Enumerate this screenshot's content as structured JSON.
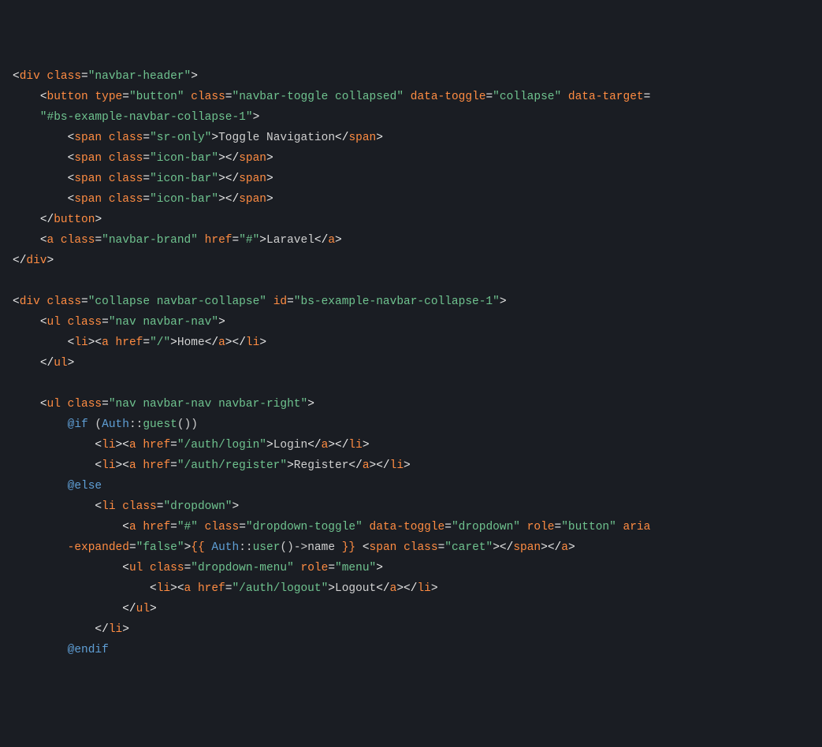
{
  "t": {
    "div": "div",
    "button": "button",
    "span": "span",
    "a": "a",
    "ul": "ul",
    "li": "li"
  },
  "a": {
    "class": "class",
    "type": "type",
    "dataToggle": "data-toggle",
    "dataTarget": "data-target",
    "href": "href",
    "id": "id",
    "role": "role",
    "ariaExpanded": "aria\n        -expanded"
  },
  "v": {
    "navbarHeader": "\"navbar-header\"",
    "buttonType": "\"button\"",
    "navbarToggle": "\"navbar-toggle collapsed\"",
    "collapse": "\"collapse\"",
    "dataTarget": "\n    \"#bs-example-navbar-collapse-1\"",
    "srOnly": "\"sr-only\"",
    "iconBar": "\"icon-bar\"",
    "navbarBrand": "\"navbar-brand\"",
    "hrefHash": "\"#\"",
    "hrefRoot": "\"/\"",
    "collapseNavbar": "\"collapse navbar-collapse\"",
    "collapseId": "\"bs-example-navbar-collapse-1\"",
    "navNavbar": "\"nav navbar-nav\"",
    "navNavbarRight": "\"nav navbar-nav navbar-right\"",
    "hrefLogin": "\"/auth/login\"",
    "hrefRegister": "\"/auth/register\"",
    "dropdown": "\"dropdown\"",
    "dropdownToggle": "\"dropdown-toggle\"",
    "dropdownVal": "\"dropdown\"",
    "roleButton": "\"button\"",
    "false": "\"false\"",
    "dropdownMenu": "\"dropdown-menu\"",
    "roleMenu": "\"menu\"",
    "hrefLogout": "\"/auth/logout\"",
    "caret": "\"caret\""
  },
  "txt": {
    "toggleNav": "Toggle Navigation",
    "laravel": "Laravel",
    "home": "Home",
    "login": "Login",
    "register": "Register",
    "logout": "Logout"
  },
  "blade": {
    "if": "@if",
    "else": "@else",
    "endif": "@endif",
    "openParen": " (",
    "auth": "Auth",
    "dblColon": "::",
    "guest": "guest",
    "user": "user",
    "parens": "()",
    "closeParen": ")",
    "arrow": "->",
    "name": "name",
    "openMust": "{{ ",
    "closeMust": " }}"
  }
}
